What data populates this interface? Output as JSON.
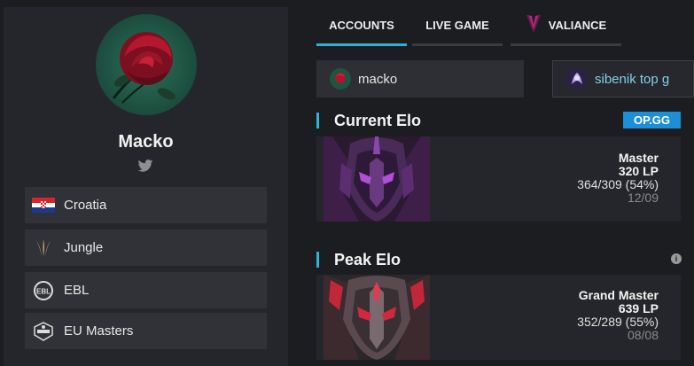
{
  "profile": {
    "name": "Macko",
    "rows": [
      {
        "icon": "croatia-flag-icon",
        "label": "Croatia"
      },
      {
        "icon": "jungle-role-icon",
        "label": "Jungle"
      },
      {
        "icon": "ebl-logo-icon",
        "label": "EBL"
      },
      {
        "icon": "eu-masters-logo-icon",
        "label": "EU Masters"
      }
    ]
  },
  "tabs": [
    {
      "label": "ACCOUNTS",
      "active": true
    },
    {
      "label": "LIVE GAME",
      "active": false
    },
    {
      "label": "VALIANCE",
      "active": false,
      "icon": "valiance-logo-icon"
    }
  ],
  "accounts": [
    {
      "name": "macko"
    },
    {
      "name": "sibenik top g"
    }
  ],
  "current_elo": {
    "title": "Current Elo",
    "badge": "OP.GG",
    "tier": "Master",
    "lp": "320 LP",
    "record": "364/309 (54%)",
    "date": "12/09"
  },
  "peak_elo": {
    "title": "Peak Elo",
    "info": "i",
    "tier": "Grand Master",
    "lp": "639 LP",
    "record": "352/289 (55%)",
    "date": "08/08"
  },
  "colors": {
    "accent": "#2bb2d4",
    "opgg": "#1d8ed8",
    "panel": "#25262b",
    "row": "#313237",
    "master": "#9b3fb8",
    "grandmaster": "#c0283a"
  }
}
